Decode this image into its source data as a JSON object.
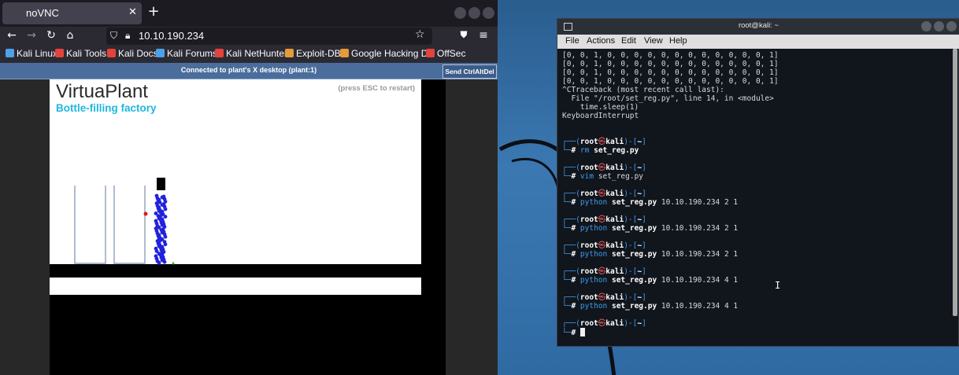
{
  "browser": {
    "tab_title": "noVNC",
    "url": "10.10.190.234",
    "bookmarks": [
      {
        "label": "Kali Linux",
        "color": "#4da1e6"
      },
      {
        "label": "Kali Tools",
        "color": "#e4433b"
      },
      {
        "label": "Kali Docs",
        "color": "#e4433b"
      },
      {
        "label": "Kali Forums",
        "color": "#4da1e6"
      },
      {
        "label": "Kali NetHunter",
        "color": "#e4433b"
      },
      {
        "label": "Exploit-DB",
        "color": "#e69a3a"
      },
      {
        "label": "Google Hacking DB",
        "color": "#e69a3a"
      },
      {
        "label": "OffSec",
        "color": "#e4433b"
      }
    ]
  },
  "novnc": {
    "status": "Connected to plant's X desktop (plant:1)",
    "ctrl_alt_del": "Send CtrlAltDel"
  },
  "plant": {
    "title": "VirtuaPlant",
    "subtitle": "Bottle-filling factory",
    "hint": "(press ESC to restart)"
  },
  "terminal": {
    "title": "root@kali: ~",
    "menu": [
      "File",
      "Actions",
      "Edit",
      "View",
      "Help"
    ],
    "output_top": [
      "[0, 0, 1, 0, 0, 0, 0, 0, 0, 0, 0, 0, 0, 0, 0, 1]",
      "[0, 0, 1, 0, 0, 0, 0, 0, 0, 0, 0, 0, 0, 0, 0, 1]",
      "[0, 0, 1, 0, 0, 0, 0, 0, 0, 0, 0, 0, 0, 0, 0, 1]",
      "[0, 0, 1, 0, 0, 0, 0, 0, 0, 0, 0, 0, 0, 0, 0, 1]",
      "^CTraceback (most recent call last):",
      "  File \"/root/set_reg.py\", line 14, in <module>",
      "    time.sleep(1)",
      "KeyboardInterrupt"
    ],
    "prompt_user": "root",
    "prompt_at": "㉿",
    "prompt_host": "kali",
    "prompt_dir": "~",
    "commands": [
      {
        "cmd": "rm",
        "arg_bold": "set_reg.py",
        "rest": ""
      },
      {
        "cmd": "vim",
        "arg_bold": "",
        "rest": "set_reg.py"
      },
      {
        "cmd": "python",
        "arg_bold": "set_reg.py",
        "rest": "10.10.190.234 2 1"
      },
      {
        "cmd": "python",
        "arg_bold": "set_reg.py",
        "rest": "10.10.190.234 2 1"
      },
      {
        "cmd": "python",
        "arg_bold": "set_reg.py",
        "rest": "10.10.190.234 2 1"
      },
      {
        "cmd": "python",
        "arg_bold": "set_reg.py",
        "rest": "10.10.190.234 4 1"
      },
      {
        "cmd": "python",
        "arg_bold": "set_reg.py",
        "rest": "10.10.190.234 4 1"
      }
    ]
  }
}
